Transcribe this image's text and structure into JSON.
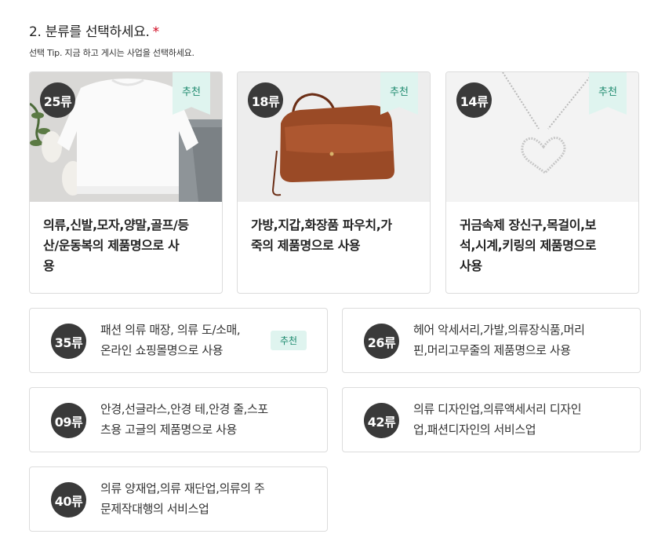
{
  "question": {
    "title": "2. 분류를 선택하세요.",
    "required_mark": "*",
    "tip": "선택 Tip. 지금 하고 게시는 사업을 선택하세요."
  },
  "recommend_label": "추천",
  "big_cards": [
    {
      "class_label": "25류",
      "lines": [
        "의류,신발,모자,양말,골프/등",
        "산/운동복의 제품명으로 사",
        "용"
      ],
      "recommended": true,
      "image": "sweatshirt-photo"
    },
    {
      "class_label": "18류",
      "lines": [
        "가방,지갑,화장품 파우치,가",
        "죽의 제품명으로 사용"
      ],
      "recommended": true,
      "image": "handbag-photo"
    },
    {
      "class_label": "14류",
      "lines": [
        "귀금속제 장신구,목걸이,보",
        "석,시계,키링의 제품명으로",
        "사용"
      ],
      "recommended": true,
      "image": "necklace-photo"
    }
  ],
  "small_cards": [
    {
      "class_label": "35류",
      "lines": [
        "패션 의류 매장, 의류 도/소매,",
        "온라인 쇼핑몰명으로 사용"
      ],
      "recommended": true
    },
    {
      "class_label": "26류",
      "lines": [
        "헤어 악세서리,가발,의류장식품,머리",
        "핀,머리고무줄의 제품명으로 사용"
      ],
      "recommended": false
    },
    {
      "class_label": "09류",
      "lines": [
        "안경,선글라스,안경 테,안경 줄,스포",
        "츠용 고글의 제품명으로 사용"
      ],
      "recommended": false
    },
    {
      "class_label": "42류",
      "lines": [
        "의류 디자인업,의류액세서리 디자인",
        "업,패션디자인의 서비스업"
      ],
      "recommended": false
    },
    {
      "class_label": "40류",
      "lines": [
        "의류 양재업,의류 재단업,의류의 주",
        "문제작대행의 서비스업"
      ],
      "recommended": false
    }
  ],
  "colors": {
    "badge_bg": "#3a3a3a",
    "recommend_bg": "#dff4ef",
    "recommend_text": "#1f8a6f",
    "required": "#d0021b",
    "card_border": "#dcdcdc"
  }
}
